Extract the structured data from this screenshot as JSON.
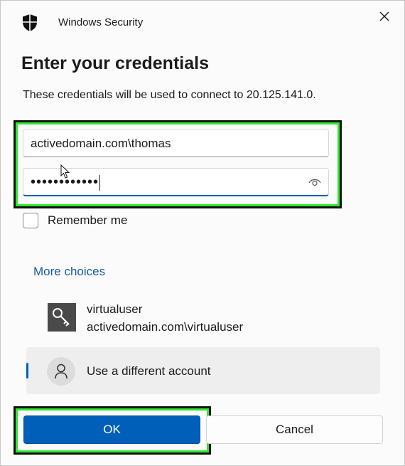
{
  "window": {
    "app_title": "Windows Security",
    "close_icon": "close-icon"
  },
  "dialog": {
    "heading": "Enter your credentials",
    "description": "These credentials will be used to connect to 20.125.141.0."
  },
  "form": {
    "username_value": "activedomain.com\\thomas",
    "password_masked": "••••••••••••",
    "reveal_icon": "eye-icon",
    "remember_label": "Remember me",
    "remember_checked": false
  },
  "more_choices": {
    "label": "More choices",
    "accounts": [
      {
        "name": "virtualuser",
        "detail": "activedomain.com\\virtualuser",
        "icon": "key-icon"
      },
      {
        "name": "Use a different account",
        "icon": "person-icon",
        "selected": true
      }
    ]
  },
  "buttons": {
    "ok_label": "OK",
    "cancel_label": "Cancel"
  },
  "colors": {
    "accent": "#005fb8",
    "link": "#1a5aa6",
    "highlight": "#2ee82e"
  }
}
